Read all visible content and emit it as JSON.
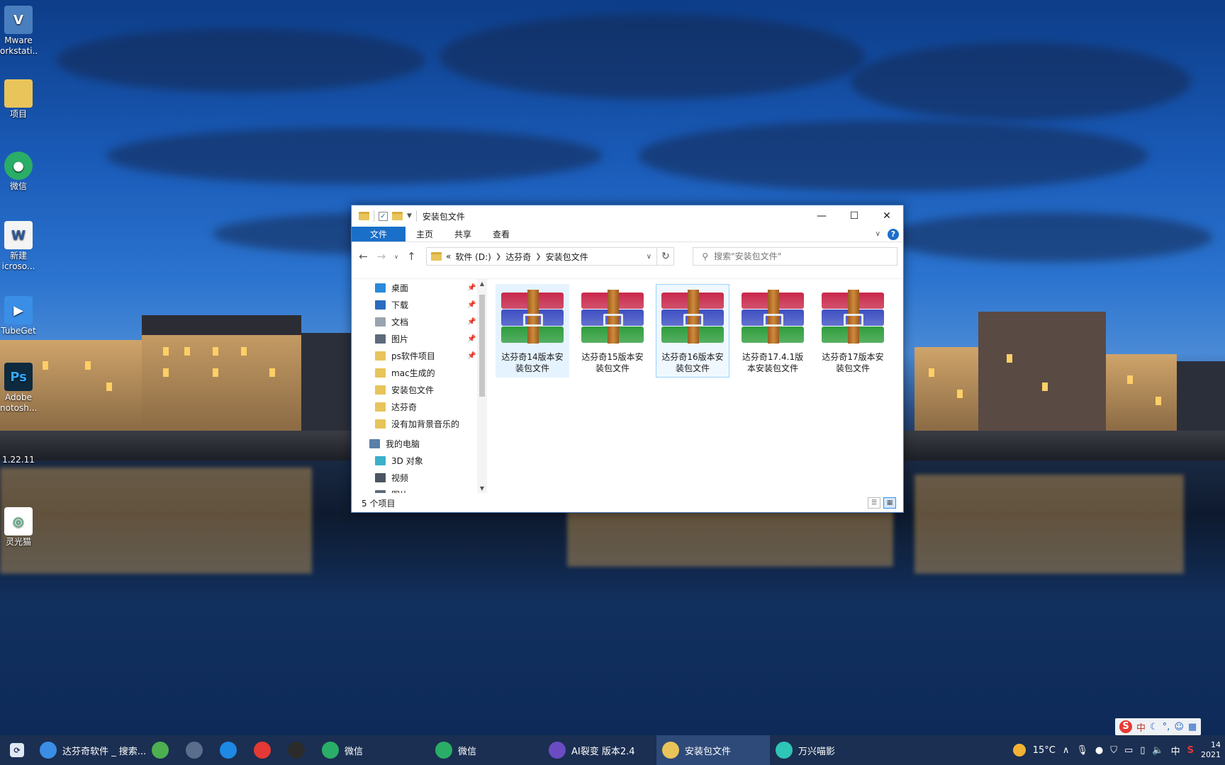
{
  "desktop": {
    "icons": [
      {
        "label1": "Mware",
        "label2": "orkstati...",
        "icon": "vmware-icon"
      },
      {
        "label1": "项目",
        "label2": "",
        "icon": "folder-icon"
      },
      {
        "label1": "微信",
        "label2": "",
        "icon": "wechat-icon"
      },
      {
        "label1": "新建",
        "label2": "icroso...",
        "icon": "word-doc-icon"
      },
      {
        "label1": "TubeGet",
        "label2": "",
        "icon": "tubeget-icon"
      },
      {
        "label1": "Adobe",
        "label2": "notosh...",
        "icon": "photoshop-icon"
      },
      {
        "label1": "1.22.11",
        "label2": "",
        "icon": "file-icon"
      },
      {
        "label1": "灵光猫",
        "label2": "",
        "icon": "app-icon"
      }
    ]
  },
  "window": {
    "title": "安装包文件",
    "controls": {
      "minimize": "—",
      "maximize": "☐",
      "close": "✕"
    },
    "ribbon_tabs": [
      "文件",
      "主页",
      "共享",
      "查看"
    ],
    "address": {
      "prefix": "«",
      "crumbs": [
        "软件 (D:)",
        "达芬奇",
        "安装包文件"
      ]
    },
    "search_placeholder": "搜索\"安装包文件\"",
    "sidebar": {
      "quick_access": [
        {
          "label": "桌面",
          "pinned": true,
          "color": "#2a8ad8"
        },
        {
          "label": "下载",
          "pinned": true,
          "color": "#2a6cbf"
        },
        {
          "label": "文档",
          "pinned": true,
          "color": "#9aa4b0"
        },
        {
          "label": "图片",
          "pinned": true,
          "color": "#5c6b7a"
        },
        {
          "label": "ps软件项目",
          "pinned": true,
          "color": "#e8c45a"
        },
        {
          "label": "mac生成的",
          "pinned": false,
          "color": "#e8c45a"
        },
        {
          "label": "安装包文件",
          "pinned": false,
          "color": "#e8c45a"
        },
        {
          "label": "达芬奇",
          "pinned": false,
          "color": "#e8c45a"
        },
        {
          "label": "没有加背景音乐的",
          "pinned": false,
          "color": "#e8c45a"
        }
      ],
      "this_pc": "我的电脑",
      "pc_items": [
        {
          "label": "3D 对象",
          "color": "#3bb0c9"
        },
        {
          "label": "视频",
          "color": "#4b5563"
        },
        {
          "label": "图片",
          "color": "#5c6b7a"
        }
      ]
    },
    "files": [
      {
        "line1": "达芬奇14版本安",
        "line2": "装包文件"
      },
      {
        "line1": "达芬奇15版本安",
        "line2": "装包文件"
      },
      {
        "line1": "达芬奇16版本安",
        "line2": "装包文件"
      },
      {
        "line1": "达芬奇17.4.1版",
        "line2": "本安装包文件"
      },
      {
        "line1": "达芬奇17版本安",
        "line2": "装包文件"
      }
    ],
    "status": "5 个项目"
  },
  "taskbar": {
    "items": [
      {
        "label": "达芬奇软件 _ 搜索...",
        "color": "#3a8ee6"
      },
      {
        "label": "",
        "color": "#4caf50"
      },
      {
        "label": "",
        "color": "#5a6d8c"
      },
      {
        "label": "",
        "color": "#1e88e5"
      },
      {
        "label": "",
        "color": "#e53935"
      },
      {
        "label": "",
        "color": "#2b2b2b"
      },
      {
        "label": "微信",
        "color": "#2aae67"
      },
      {
        "label": "微信",
        "color": "#2aae67"
      },
      {
        "label": "AI裂变  版本2.4",
        "color": "#6a4bc4"
      },
      {
        "label": "安装包文件",
        "color": "#e8c45a"
      },
      {
        "label": "万兴喵影",
        "color": "#2ec4b6"
      }
    ],
    "weather": "15°C",
    "ime": "中",
    "time_partial": "14",
    "date_partial": "2021"
  },
  "ime_bar": {
    "logo": "S",
    "lang": "中"
  }
}
